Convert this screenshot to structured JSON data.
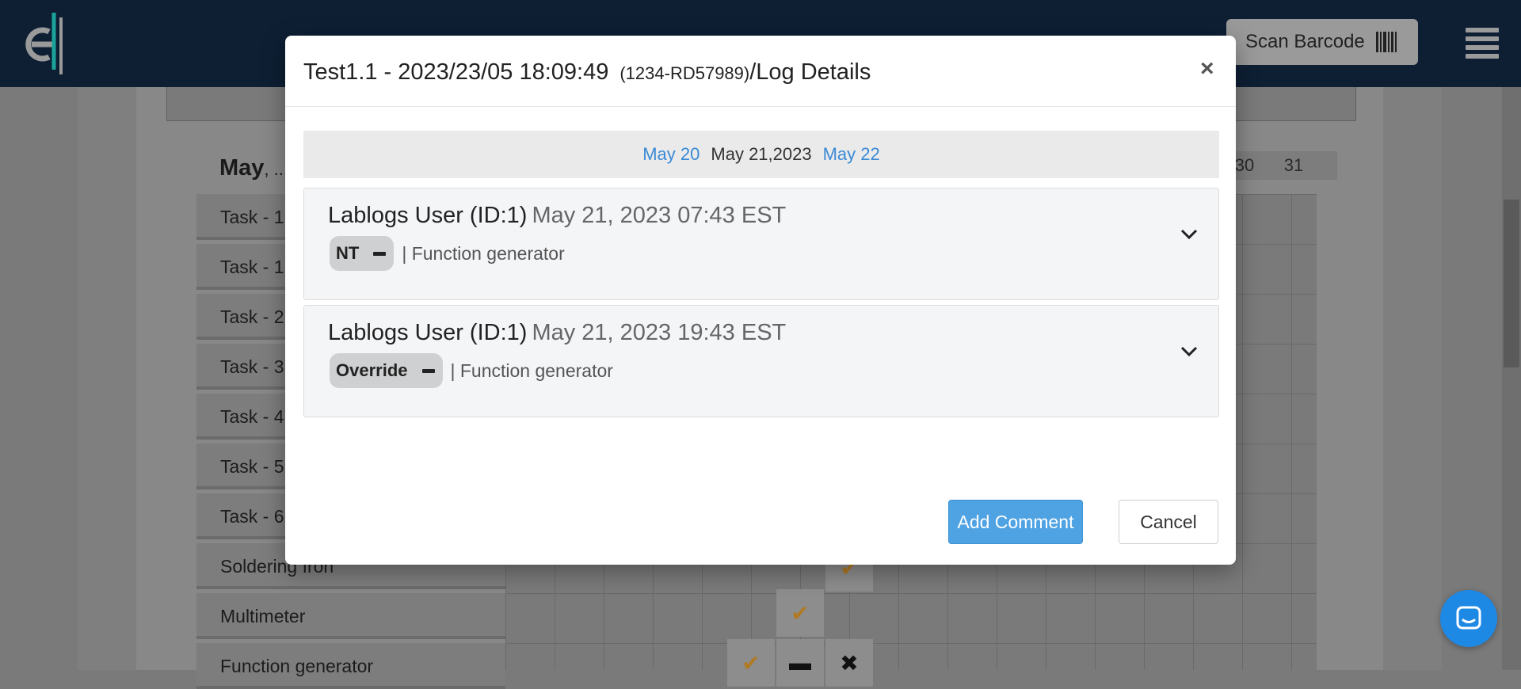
{
  "header": {
    "scan_label": "Scan Barcode"
  },
  "background": {
    "month": "May",
    "month_rest": ", ...",
    "day_numbers": [
      "30",
      "31"
    ],
    "rows": [
      "Task - 1",
      "Task - 1",
      "Task - 2",
      "Task - 3",
      "Task - 4",
      "Task - 5",
      "Task - 6",
      "Soldering Iron",
      "Multimeter",
      "Function generator"
    ]
  },
  "modal": {
    "title_main": "Test1.1 - 2023/23/05 18:09:49",
    "title_code": "(1234-RD57989)",
    "title_suffix": "/Log Details",
    "close": "×",
    "date_nav": {
      "prev": "May 20",
      "current": "May 21,2023",
      "next": "May 22"
    },
    "logs": [
      {
        "user": "Lablogs User (ID:1)",
        "time": "May 21, 2023 07:43 EST",
        "status": "NT",
        "equipment": "| Function generator"
      },
      {
        "user": "Lablogs User (ID:1)",
        "time": "May 21, 2023 19:43 EST",
        "status": "Override",
        "equipment": "| Function generator"
      }
    ],
    "add_comment_label": "Add Comment",
    "cancel_label": "Cancel"
  },
  "colors": {
    "topbar": "#0e1f34",
    "link": "#3a8ad6",
    "primary_button": "#4fa3e3",
    "check_mark": "#c8892c"
  }
}
